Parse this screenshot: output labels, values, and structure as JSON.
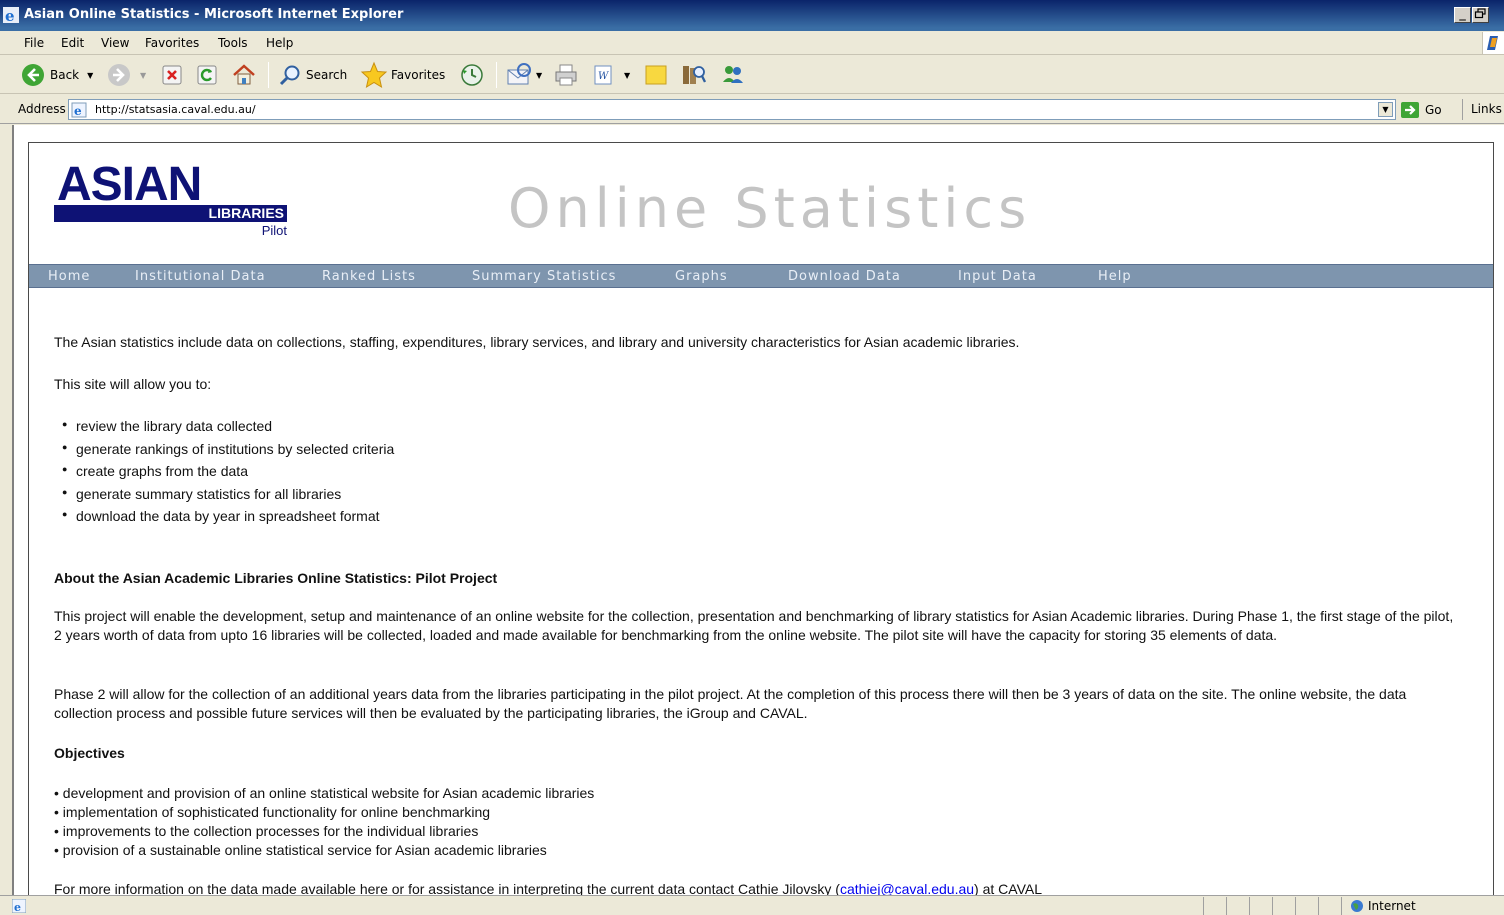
{
  "window": {
    "title": "Asian Online Statistics - Microsoft Internet Explorer",
    "minimize": "_",
    "maximize": "5"
  },
  "menu": [
    "File",
    "Edit",
    "View",
    "Favorites",
    "Tools",
    "Help"
  ],
  "toolbar": {
    "back": "Back",
    "search": "Search",
    "favorites": "Favorites"
  },
  "address": {
    "label": "Address",
    "url": "http://statsasia.caval.edu.au/",
    "go": "Go",
    "links": "Links"
  },
  "logo": {
    "asian": "ASIAN",
    "libraries": "LIBRARIES",
    "pilot": "Pilot"
  },
  "site_title": "Online Statistics",
  "nav": [
    "Home",
    "Institutional Data",
    "Ranked Lists",
    "Summary Statistics",
    "Graphs",
    "Download Data",
    "Input Data",
    "Help"
  ],
  "content": {
    "intro": "The Asian statistics include data on collections, staffing, expenditures, library services, and library and university characteristics for Asian academic libraries.",
    "allow": "This site will allow you to:",
    "bullets": [
      "review the library data collected",
      "generate rankings of institutions by selected criteria",
      "create graphs from the data",
      "generate summary statistics for all libraries",
      "download the data by year in spreadsheet format"
    ],
    "about_heading": "About the Asian Academic Libraries Online Statistics: Pilot Project",
    "about_p1": "This project will enable the development, setup and maintenance of an online website for the collection, presentation and benchmarking of library statistics for Asian Academic libraries. During Phase 1, the first stage of the pilot, 2 years worth of data from upto 16 libraries will be collected, loaded and made available for benchmarking from the online website. The pilot site will have the capacity for storing 35 elements of data.",
    "about_p2": "Phase 2 will allow for the collection of an additional years data from the libraries participating in the pilot project. At the completion of this process there will then be 3 years of data on the site. The online website, the data collection process and possible future services will then be evaluated by the participating libraries, the iGroup and CAVAL.",
    "objectives_heading": "Objectives",
    "objectives": [
      "• development and provision of an online statistical website for Asian academic libraries",
      "• implementation of sophisticated functionality for online benchmarking",
      "• improvements to the collection processes for the individual libraries",
      "• provision of a sustainable online statistical service for Asian academic libraries"
    ],
    "contact_pre": "For more information on the data made available here or for assistance in interpreting the current data contact Cathie Jilovsky (",
    "contact_email": "cathiej@caval.edu.au",
    "contact_post": ") at CAVAL"
  },
  "status": {
    "zone": "Internet"
  }
}
